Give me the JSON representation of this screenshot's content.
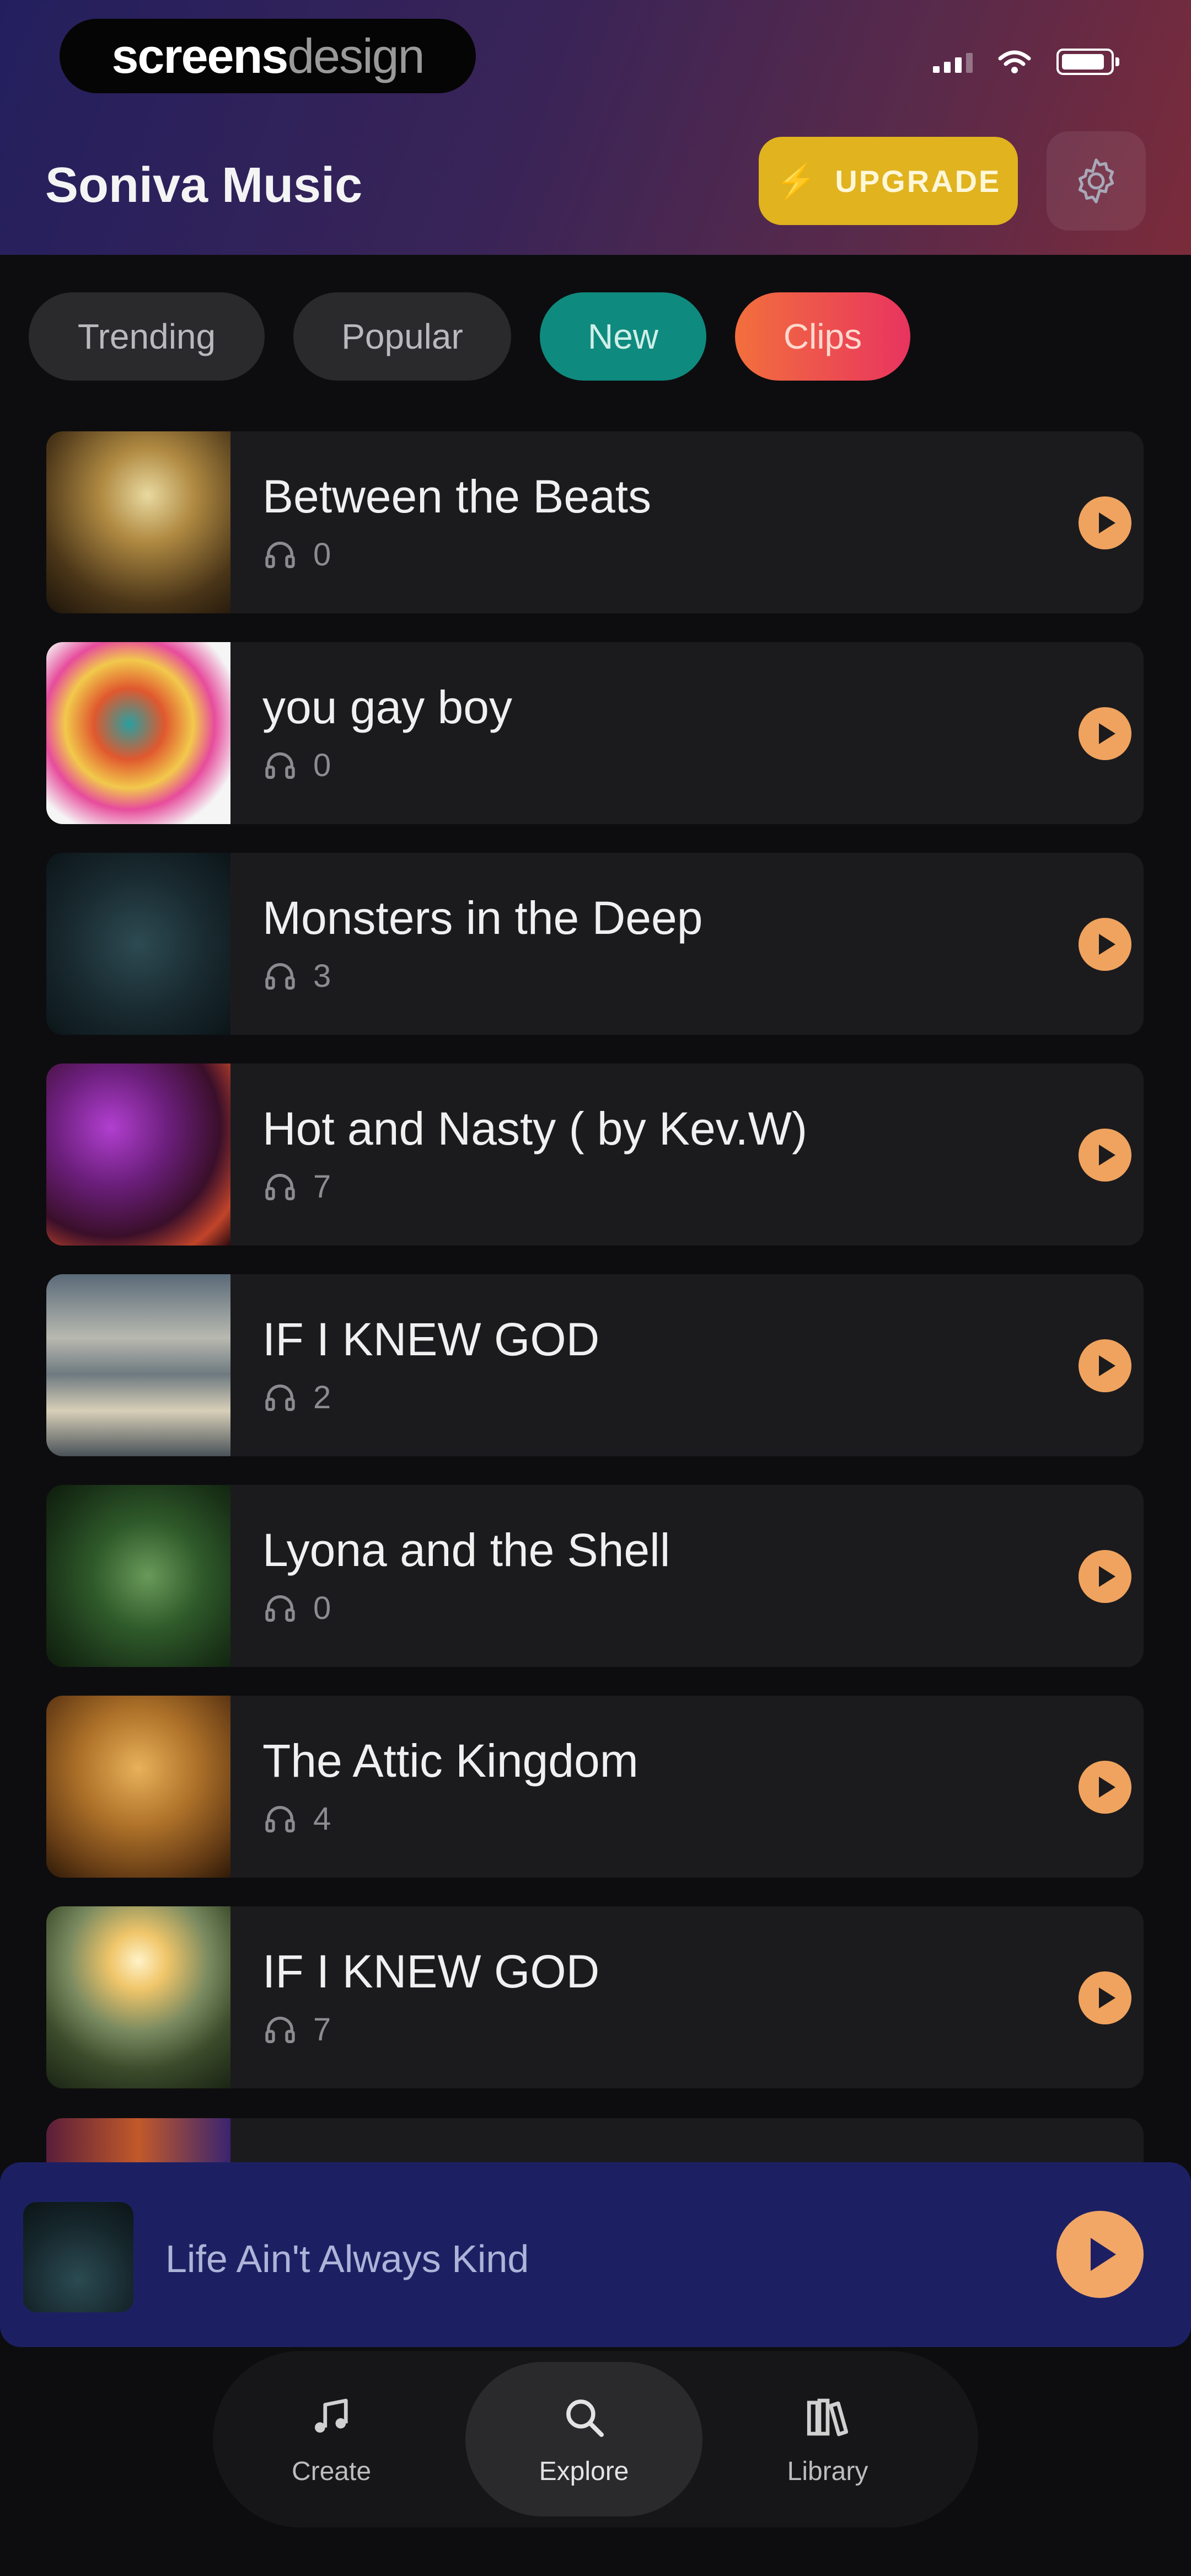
{
  "status_bar": {
    "brand_bold": "screens",
    "brand_light": "design"
  },
  "header": {
    "app_title": "Soniva Music",
    "upgrade_label": "UPGRADE"
  },
  "filters": [
    "Trending",
    "Popular",
    "New",
    "Clips"
  ],
  "songs": [
    {
      "title": "Between the Beats",
      "plays": "0"
    },
    {
      "title": "you gay boy",
      "plays": "0"
    },
    {
      "title": "Monsters in the Deep",
      "plays": "3"
    },
    {
      "title": "Hot and Nasty ( by Kev.W)",
      "plays": "7"
    },
    {
      "title": "IF I KNEW GOD",
      "plays": "2"
    },
    {
      "title": "Lyona and the Shell",
      "plays": "0"
    },
    {
      "title": "The Attic Kingdom",
      "plays": "4"
    },
    {
      "title": "IF I KNEW GOD",
      "plays": "7"
    }
  ],
  "now_playing": {
    "title": "Life Ain't Always Kind"
  },
  "nav": {
    "create": "Create",
    "explore": "Explore",
    "library": "Library"
  },
  "colors": {
    "accent_play": "#f0a35e",
    "upgrade_bg": "#e0b31f",
    "pill_new": "#0f8a7e",
    "pill_clips_start": "#f26f3d",
    "pill_clips_end": "#e8345f",
    "now_playing_bg": "#1c2063"
  },
  "icons": {
    "plays": "headphones-icon",
    "row_action": "play-icon",
    "settings": "gear-icon",
    "upgrade": "lightning-bolt-icon",
    "create": "music-notes-icon",
    "explore": "search-icon",
    "library": "library-books-icon"
  }
}
